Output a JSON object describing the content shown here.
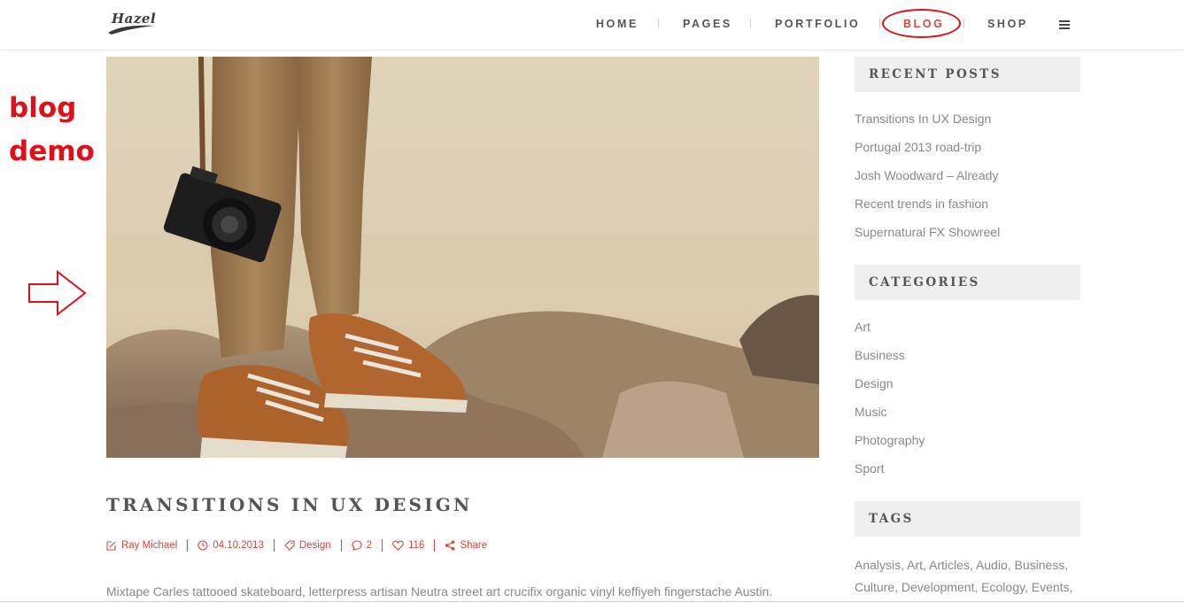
{
  "header": {
    "logo_text": "Hazel",
    "nav": [
      {
        "label": "HOME"
      },
      {
        "label": "PAGES"
      },
      {
        "label": "PORTFOLIO"
      },
      {
        "label": "BLOG",
        "active": true
      },
      {
        "label": "SHOP"
      }
    ],
    "menu_icon": "hamburger-icon"
  },
  "annotation": {
    "label": "blog\ndemo",
    "arrow_icon": "right-arrow-outline-icon",
    "color": "#e0101a"
  },
  "post": {
    "image_alt": "Hiker with camera standing on rocks",
    "title": "TRANSITIONS IN UX DESIGN",
    "meta": {
      "author": "Ray Michael",
      "date": "04.10.2013",
      "category": "Design",
      "comments": "2",
      "likes": "116",
      "share": "Share"
    },
    "excerpt": "Mixtape Carles tattooed skateboard, letterpress artisan Neutra street art crucifix organic vinyl keffiyeh fingerstache Austin."
  },
  "sidebar": {
    "recent_posts": {
      "heading": "RECENT POSTS",
      "items": [
        "Transitions In UX Design",
        "Portugal 2013 road-trip",
        "Josh Woodward – Already",
        "Recent trends in fashion",
        "Supernatural FX Showreel"
      ]
    },
    "categories": {
      "heading": "CATEGORIES",
      "items": [
        "Art",
        "Business",
        "Design",
        "Music",
        "Photography",
        "Sport"
      ]
    },
    "tags": {
      "heading": "TAGS",
      "text": "Analysis, Art, Articles, Audio, Business, Culture, Development, Ecology, Events,"
    }
  },
  "colors": {
    "accent": "#d9453a",
    "annotation_red": "#e0101a",
    "widget_bg": "#efefef"
  }
}
